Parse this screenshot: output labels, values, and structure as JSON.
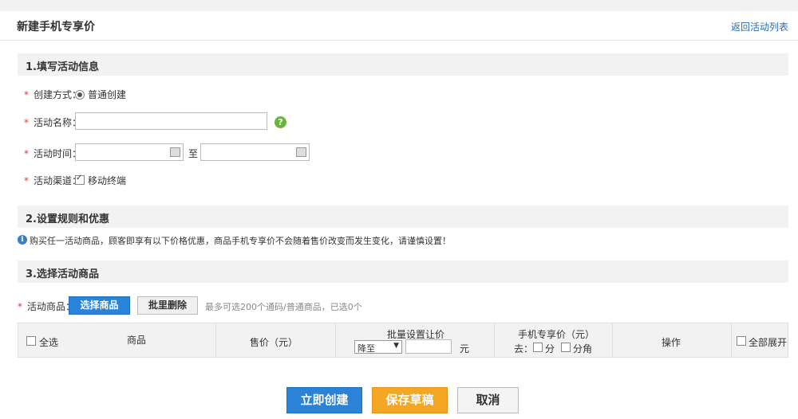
{
  "header": {
    "title": "新建手机专享价",
    "back_link": "返回活动列表"
  },
  "sections": {
    "s1": "1.填写活动信息",
    "s2": "2.设置规则和优惠",
    "s3": "3.选择活动商品"
  },
  "form": {
    "create_mode_label": "创建方式：",
    "create_mode_value": "普通创建",
    "name_label": "活动名称：",
    "name_value": "",
    "time_label": "活动时间：",
    "time_sep": "至",
    "channel_label": "活动渠道：",
    "channel_value": "移动终端"
  },
  "notice": "购买任一活动商品，顾客即享有以下价格优惠，商品手机专享价不会随着售价改变而发生变化，请谨慎设置！",
  "products": {
    "label": "活动商品：",
    "select_button": "选择商品",
    "batch_delete_button": "批里删除",
    "hint": "最多可选200个通码/普通商品，已选0个"
  },
  "table": {
    "select_all": "全选",
    "col_product": "商品",
    "col_price": "售价（元）",
    "col_batch": "批量设置让价",
    "batch_select_value": "降至",
    "batch_unit": "元",
    "col_mobile_price": "手机专享价（元）",
    "mobile_prefix": "去：",
    "mobile_fen": "分",
    "mobile_jiao": "分角",
    "col_action": "操作",
    "expand_all": "全部展开"
  },
  "actions": {
    "create": "立即创建",
    "save_draft": "保存草稿",
    "cancel": "取消"
  },
  "colors": {
    "blue": "#2a83d6",
    "orange": "#f5a623",
    "required_star": "#e4393c",
    "help_green": "#6cb33e"
  }
}
